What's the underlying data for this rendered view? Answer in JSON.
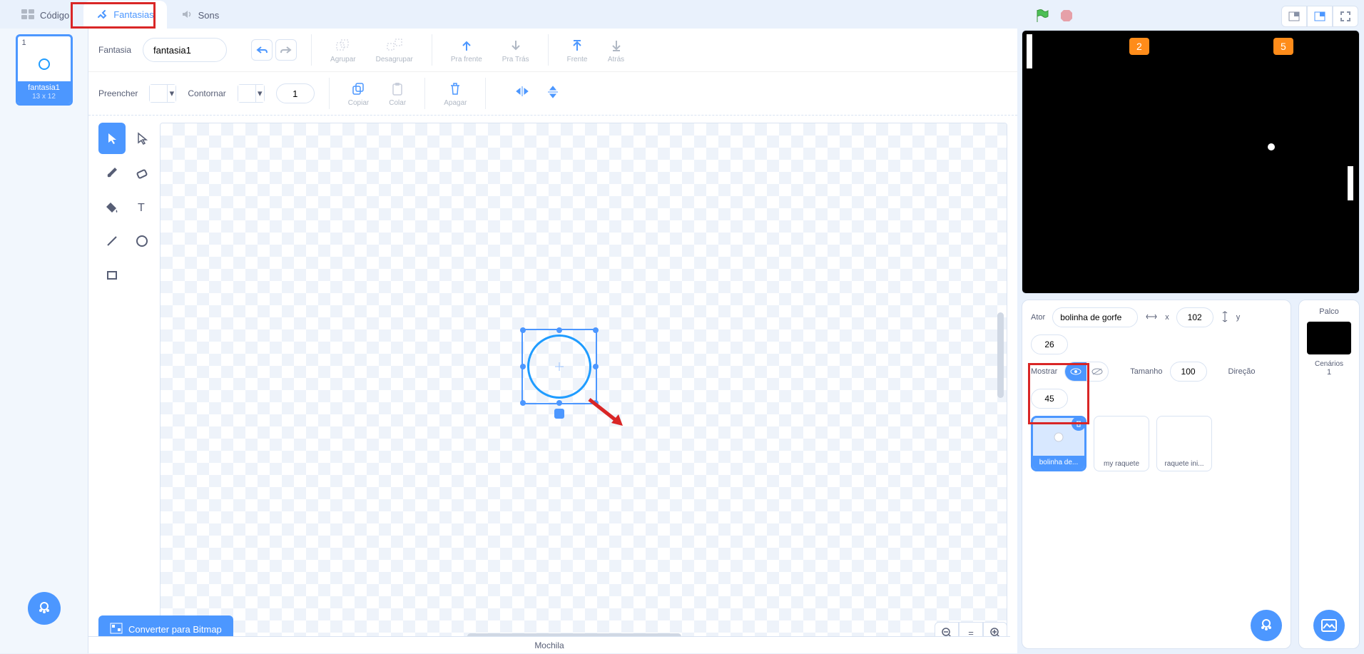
{
  "tabs": {
    "code": "Código",
    "costumes": "Fantasias",
    "sounds": "Sons"
  },
  "costume_list": {
    "num": "1",
    "name": "fantasia1",
    "dim": "13 x 12"
  },
  "toolbar": {
    "costume_label": "Fantasia",
    "costume_name": "fantasia1",
    "group": "Agrupar",
    "ungroup": "Desagrupar",
    "forward": "Pra frente",
    "backward": "Pra Trás",
    "front": "Frente",
    "back": "Atrás",
    "fill": "Preencher",
    "outline": "Contornar",
    "outline_width": "1",
    "copy": "Copiar",
    "paste": "Colar",
    "delete": "Apagar"
  },
  "bitmap_button": "Converter para Bitmap",
  "sprite_info": {
    "actor_label": "Ator",
    "actor_name": "bolinha de gorfe",
    "x_label": "x",
    "x": "102",
    "y_label": "y",
    "y": "26",
    "show_label": "Mostrar",
    "size_label": "Tamanho",
    "size": "100",
    "direction_label": "Direção",
    "direction": "45"
  },
  "sprites": [
    "bolinha de...",
    "my raquete",
    "raquete ini..."
  ],
  "stage_panel": {
    "title": "Palco",
    "backdrops_label": "Cenários",
    "backdrops_count": "1"
  },
  "stage_scores": {
    "s1": "2",
    "s2": "5"
  },
  "backpack": "Mochila",
  "zoom_symbols": {
    "out": "−",
    "eq": "=",
    "in": "+"
  }
}
